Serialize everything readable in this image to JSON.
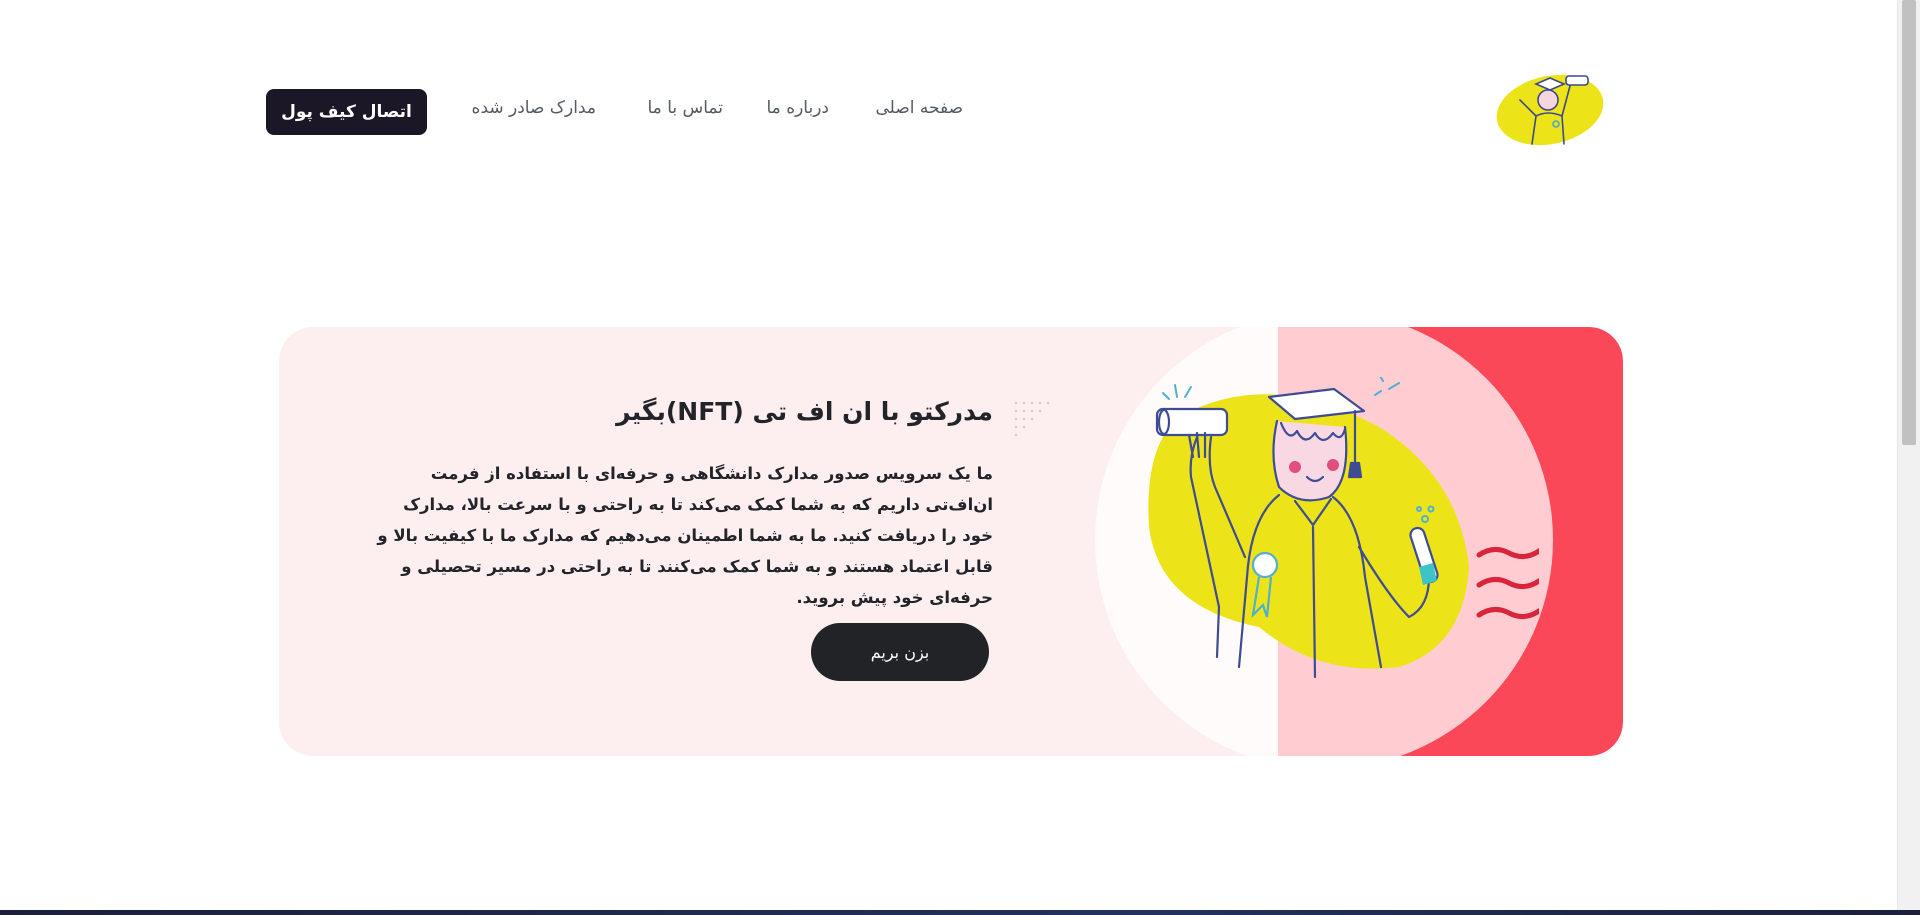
{
  "header": {
    "nav": [
      {
        "label": "صفحه اصلی"
      },
      {
        "label": "درباره ما"
      },
      {
        "label": "تماس با ما"
      },
      {
        "label": "مدارک صادر شده"
      }
    ],
    "connect_wallet_label": "اتصال کیف پول"
  },
  "hero": {
    "title": "مدرکتو با ان اف تی (NFT)بگیر",
    "description": "ما یک سرویس صدور مدارک دانشگاهی و حرفه‌ای با استفاده از فرمت ان‌اف‌تی داریم که به شما کمک می‌کند تا به راحتی و با سرعت بالا، مدارک خود را دریافت کنید. ما به شما اطمینان می‌دهیم که مدارک ما با کیفیت بالا و قابل اعتماد هستند و به شما کمک می‌کنند تا به راحتی در مسیر تحصیلی و حرفه‌ای خود پیش بروید.",
    "cta_label": "بزن بریم",
    "illustration": "graduate-with-diploma"
  },
  "colors": {
    "accent_red": "#fb4859",
    "hero_bg": "#fdeff0",
    "blob_yellow": "#ece319",
    "dark_button": "#1c1727"
  }
}
